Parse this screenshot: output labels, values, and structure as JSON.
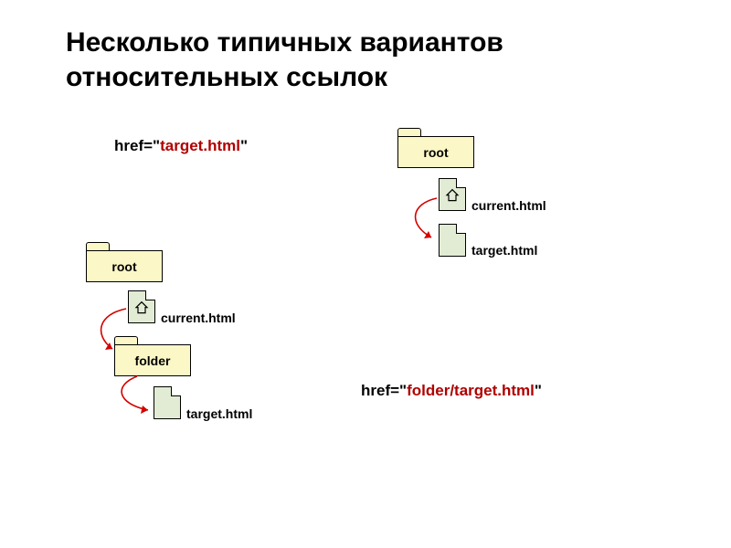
{
  "title": "Несколько типичных вариантов\nотносительных ссылок",
  "href1": {
    "prefix": "href=\"",
    "value": "target.html",
    "suffix": "\""
  },
  "href2": {
    "prefix": "href=\"",
    "value": "folder/target.html",
    "suffix": "\""
  },
  "example1": {
    "root_label": "root",
    "current_label": "current.html",
    "target_label": "target.html"
  },
  "example2": {
    "root_label": "root",
    "current_label": "current.html",
    "folder_label": "folder",
    "target_label": "target.html"
  }
}
